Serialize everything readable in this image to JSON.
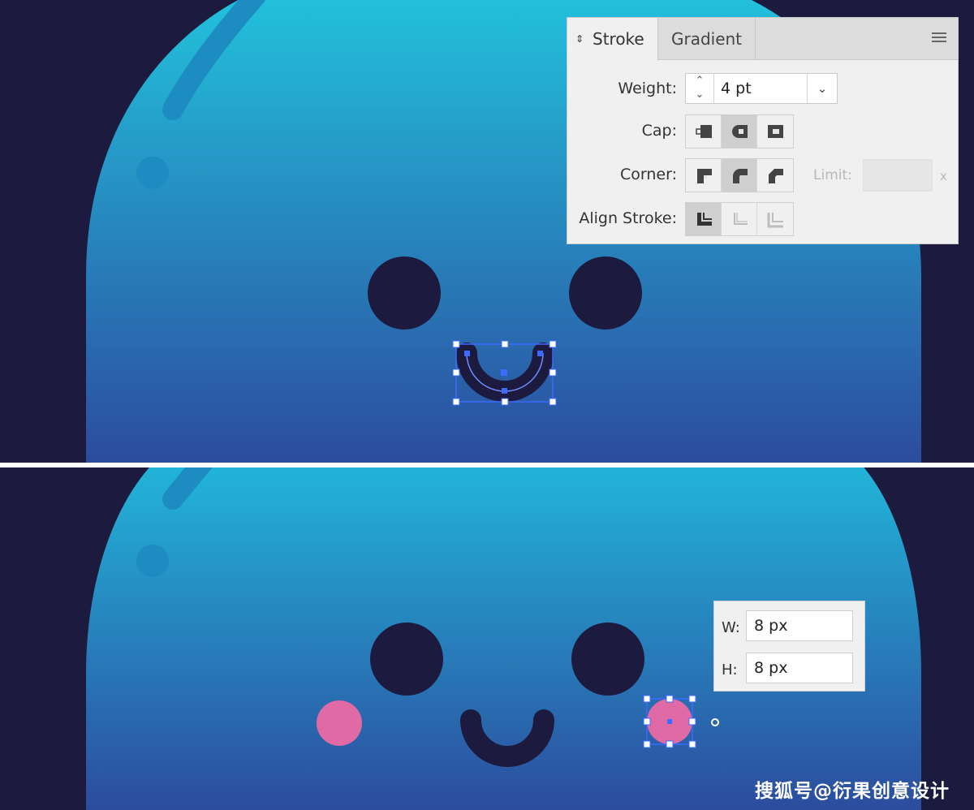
{
  "stroke_panel": {
    "tabs": [
      {
        "label": "Stroke",
        "active": true
      },
      {
        "label": "Gradient",
        "active": false
      }
    ],
    "weight": {
      "label": "Weight:",
      "value": "4 pt"
    },
    "cap": {
      "label": "Cap:",
      "options": [
        "butt-cap-icon",
        "round-cap-icon",
        "projecting-cap-icon"
      ],
      "selected": "round-cap-icon"
    },
    "corner": {
      "label": "Corner:",
      "options": [
        "miter-join-icon",
        "round-join-icon",
        "bevel-join-icon"
      ],
      "selected": "round-join-icon"
    },
    "limit": {
      "label": "Limit:",
      "unit": "x"
    },
    "align_stroke": {
      "label": "Align Stroke:",
      "options": [
        "align-center-icon",
        "align-inside-icon",
        "align-outside-icon"
      ],
      "selected": "align-center-icon"
    }
  },
  "size_panel": {
    "w": {
      "label": "W:",
      "value": "8 px"
    },
    "h": {
      "label": "H:",
      "value": "8 px"
    }
  },
  "watermark": "搜狐号@衍果创意设计",
  "colors": {
    "background": "#1c1a3e",
    "body_top": "#22c0dc",
    "body_bottom": "#2c4c9e",
    "face": "#1c1a3e",
    "cheek": "#e06aa6",
    "selection": "#3d6bff"
  }
}
